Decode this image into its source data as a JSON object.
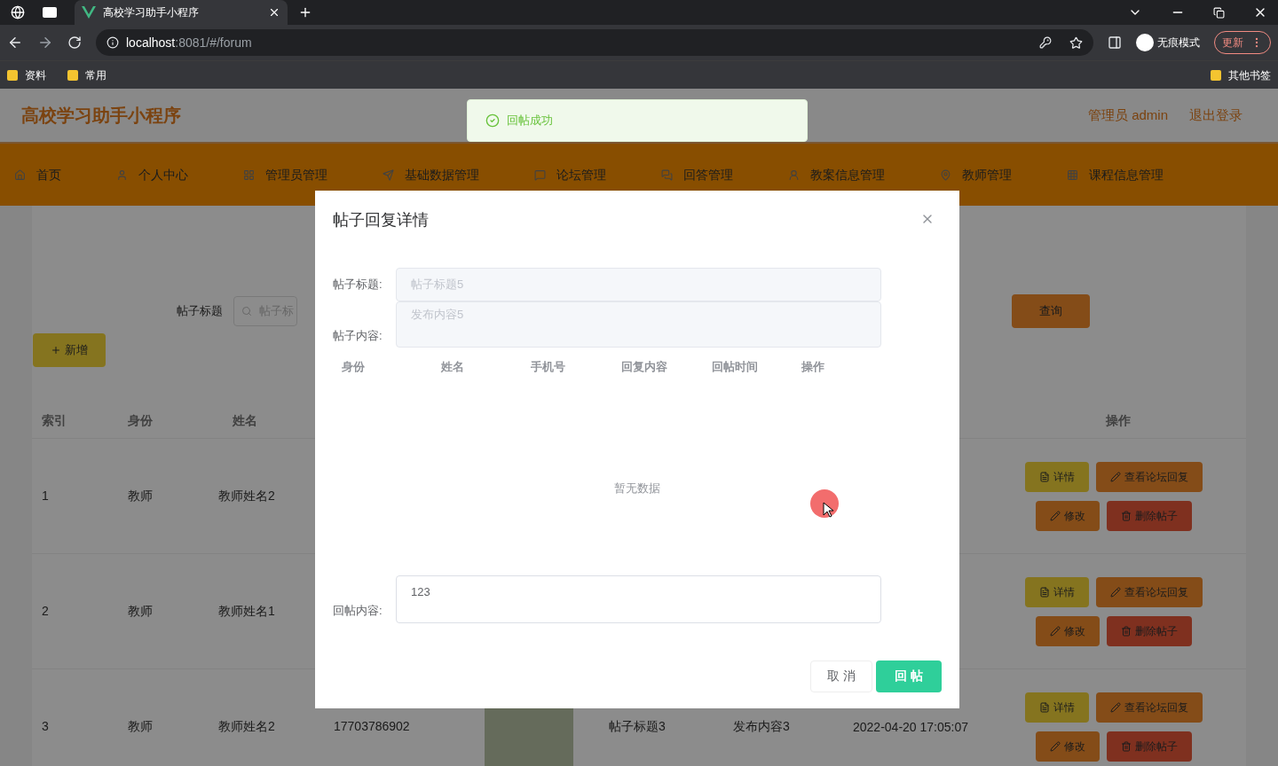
{
  "browser": {
    "tab_title": "高校学习助手小程序",
    "url_host": "localhost",
    "url_rest": ":8081/#/forum",
    "incognito_label": "无痕模式",
    "update_label": "更新",
    "bookmarks": [
      "资料",
      "常用"
    ],
    "other_bookmarks": "其他书签"
  },
  "header": {
    "title": "高校学习助手小程序",
    "user": "管理员 admin",
    "logout": "退出登录"
  },
  "nav": [
    {
      "label": "首页"
    },
    {
      "label": "个人中心"
    },
    {
      "label": "管理员管理"
    },
    {
      "label": "基础数据管理"
    },
    {
      "label": "论坛管理"
    },
    {
      "label": "回答管理"
    },
    {
      "label": "教案信息管理"
    },
    {
      "label": "教师管理"
    },
    {
      "label": "课程信息管理"
    }
  ],
  "search": {
    "label": "帖子标题",
    "placeholder": "帖子标",
    "button": "查询"
  },
  "add_button": "新增",
  "table": {
    "columns": [
      "索引",
      "身份",
      "姓名",
      "操作"
    ],
    "rows": [
      {
        "index": "1",
        "role": "教师",
        "name": "教师姓名2",
        "photo": false,
        "actions": [
          {
            "kind": "detail",
            "label": "详情"
          },
          {
            "kind": "reply",
            "label": "查看论坛回复"
          },
          {
            "kind": "edit",
            "label": "修改"
          },
          {
            "kind": "delete",
            "label": "删除帖子"
          }
        ]
      },
      {
        "index": "2",
        "role": "教师",
        "name": "教师姓名1",
        "photo": false,
        "actions": [
          {
            "kind": "detail",
            "label": "详情"
          },
          {
            "kind": "reply",
            "label": "查看论坛回复"
          },
          {
            "kind": "edit",
            "label": "修改"
          },
          {
            "kind": "delete",
            "label": "删除帖子"
          }
        ]
      },
      {
        "index": "3",
        "role": "教师",
        "name": "教师姓名2",
        "phone": "17703786902",
        "photo": true,
        "title": "帖子标题3",
        "content": "发布内容3",
        "time": "2022-04-20 17:05:07",
        "actions": [
          {
            "kind": "detail",
            "label": "详情"
          },
          {
            "kind": "reply",
            "label": "查看论坛回复"
          },
          {
            "kind": "edit",
            "label": "修改"
          },
          {
            "kind": "delete",
            "label": "删除帖子"
          }
        ]
      }
    ]
  },
  "toast": {
    "message": "回帖成功"
  },
  "dialog": {
    "title": "帖子回复详情",
    "title_label": "帖子标题:",
    "title_value": "帖子标题5",
    "content_label": "帖子内容:",
    "content_value": "发布内容5",
    "reply_columns": [
      "身份",
      "姓名",
      "手机号",
      "回复内容",
      "回帖时间",
      "操作"
    ],
    "empty_text": "暂无数据",
    "reply_label": "回帖内容:",
    "reply_value": "123",
    "cancel": "取 消",
    "submit": "回 帖"
  }
}
